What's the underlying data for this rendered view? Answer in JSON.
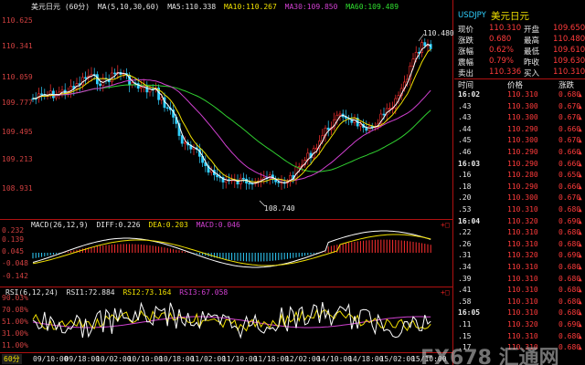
{
  "main": {
    "symbol_period": "美元日元 (60分)",
    "ma_label": "MA(5,10,30,60)",
    "ma5": "MA5:110.338",
    "ma10": "MA10:110.267",
    "ma30": "MA30:109.850",
    "ma60": "MA60:109.489",
    "y_labels": [
      "110.625",
      "110.341",
      "110.059",
      "109.777",
      "109.495",
      "109.213",
      "108.931"
    ],
    "high_annotation": "110.480",
    "low_annotation": "108.740",
    "colors": {
      "ma5": "#ffffff",
      "ma10": "#f0e000",
      "ma30": "#d040d0",
      "ma60": "#30d030",
      "up": "#ff3030",
      "down": "#30d0ff",
      "frame": "#b01010"
    }
  },
  "macd": {
    "title": "MACD(26,12,9)",
    "diff": "DIFF:0.226",
    "dea": "DEA:0.203",
    "macd": "MACD:0.046",
    "y_labels": [
      "0.232",
      "0.139",
      "0.045",
      "-0.048",
      "-0.142"
    ]
  },
  "rsi": {
    "title": "RSI(6,12,24)",
    "rsi1": "RSI1:72.884",
    "rsi2": "RSI2:73.164",
    "rsi3": "RSI3:67.058",
    "y_labels": [
      "90.03%",
      "70.08%",
      "51.00%",
      "31.00%",
      "11.00%"
    ]
  },
  "period_button": "60分",
  "dates": [
    "09/10:00",
    "09/18:00",
    "10/02:00",
    "10/10:00",
    "10/18:00",
    "11/02:00",
    "11/10:00",
    "11/18:00",
    "12/02:00",
    "14/10:00",
    "14/18:00",
    "15/02:00",
    "15/10:00"
  ],
  "quote": {
    "code": "USDJPY",
    "name": "美元日元",
    "rows": [
      {
        "l1": "现价",
        "v1": "110.310",
        "l2": "开盘",
        "v2": "109.650"
      },
      {
        "l1": "涨跌",
        "v1": "0.680",
        "l2": "最高",
        "v2": "110.480"
      },
      {
        "l1": "涨幅",
        "v1": "0.62%",
        "l2": "最低",
        "v2": "109.610"
      },
      {
        "l1": "震幅",
        "v1": "0.79%",
        "l2": "昨收",
        "v2": "109.630"
      },
      {
        "l1": "卖出",
        "v1": "110.336",
        "l2": "买入",
        "v2": "110.310"
      }
    ],
    "tick_headers": {
      "time": "时间",
      "price": "价格",
      "change": "涨跌"
    },
    "ticks": [
      {
        "t": "16:02",
        "p": "110.310",
        "c": "0.680"
      },
      {
        "t": ".43",
        "p": "110.300",
        "c": "0.670"
      },
      {
        "t": ".43",
        "p": "110.300",
        "c": "0.670"
      },
      {
        "t": ".44",
        "p": "110.290",
        "c": "0.660"
      },
      {
        "t": ".45",
        "p": "110.300",
        "c": "0.670"
      },
      {
        "t": ".46",
        "p": "110.290",
        "c": "0.660"
      },
      {
        "t": "16:03",
        "p": "110.290",
        "c": "0.660"
      },
      {
        "t": ".16",
        "p": "110.280",
        "c": "0.650"
      },
      {
        "t": ".18",
        "p": "110.290",
        "c": "0.660"
      },
      {
        "t": ".20",
        "p": "110.300",
        "c": "0.670"
      },
      {
        "t": ".53",
        "p": "110.310",
        "c": "0.680"
      },
      {
        "t": "16:04",
        "p": "110.320",
        "c": "0.690"
      },
      {
        "t": ".22",
        "p": "110.310",
        "c": "0.680"
      },
      {
        "t": ".26",
        "p": "110.310",
        "c": "0.680"
      },
      {
        "t": ".31",
        "p": "110.320",
        "c": "0.690"
      },
      {
        "t": ".34",
        "p": "110.310",
        "c": "0.680"
      },
      {
        "t": ".39",
        "p": "110.310",
        "c": "0.680"
      },
      {
        "t": ".41",
        "p": "110.310",
        "c": "0.680"
      },
      {
        "t": ".58",
        "p": "110.310",
        "c": "0.680"
      },
      {
        "t": "16:05",
        "p": "110.310",
        "c": "0.680"
      },
      {
        "t": ".11",
        "p": "110.320",
        "c": "0.690"
      },
      {
        "t": ".15",
        "p": "110.310",
        "c": "0.680"
      },
      {
        "t": ".17",
        "p": "110.310",
        "c": "0.680"
      }
    ]
  },
  "watermark": "FX678 汇通网"
}
